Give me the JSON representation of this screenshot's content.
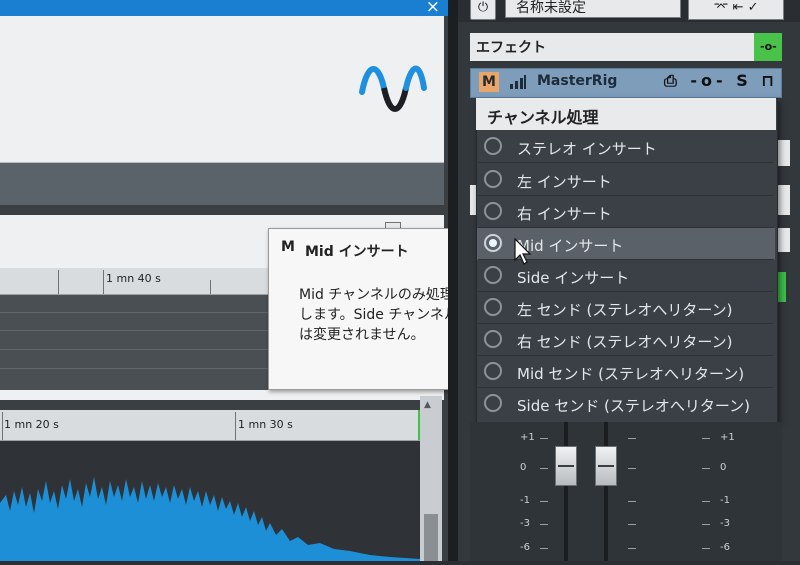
{
  "window": {
    "close_glyph": "×"
  },
  "ruler": {
    "top_label": "1 mn 40 s",
    "bottom_labels": [
      "1 mn 20 s",
      "1 mn 30 s"
    ]
  },
  "tooltip": {
    "badge": "M",
    "title": "Mid インサート",
    "body": "Mid チャンネルのみ処理します。Side チャンネルは変更されません。"
  },
  "preset": {
    "name": "名称未設定",
    "power_glyph": "⏻",
    "tools_glyph": "⌤ ⇤ ✓"
  },
  "effects": {
    "label": "エフェクト",
    "route_glyph": "-o-"
  },
  "slot": {
    "mode_badge": "M",
    "plugin_name": "MasterRig",
    "icons": "⎙ -o- S ⊓"
  },
  "channel_menu": {
    "header": "チャンネル処理",
    "items": [
      {
        "label": "ステレオ インサート",
        "selected": false
      },
      {
        "label": "左 インサート",
        "selected": false
      },
      {
        "label": "右 インサート",
        "selected": false
      },
      {
        "label": "Mid インサート",
        "selected": true
      },
      {
        "label": "Side インサート",
        "selected": false
      },
      {
        "label": "左 センド (ステレオへリターン)",
        "selected": false
      },
      {
        "label": "右 センド (ステレオへリターン)",
        "selected": false
      },
      {
        "label": "Mid センド (ステレオへリターン)",
        "selected": false
      },
      {
        "label": "Side センド (ステレオへリターン)",
        "selected": false
      }
    ]
  },
  "mixer": {
    "scale_left": [
      "+1",
      "0",
      "-1",
      "-3",
      "-6"
    ],
    "scale_right": [
      "+1",
      "0",
      "-1",
      "-3",
      "-6"
    ]
  },
  "colors": {
    "accent_blue": "#1a7fd0",
    "green": "#3dc24a",
    "slot_blue": "#7d9dbb",
    "badge_orange": "#e8a66a"
  }
}
